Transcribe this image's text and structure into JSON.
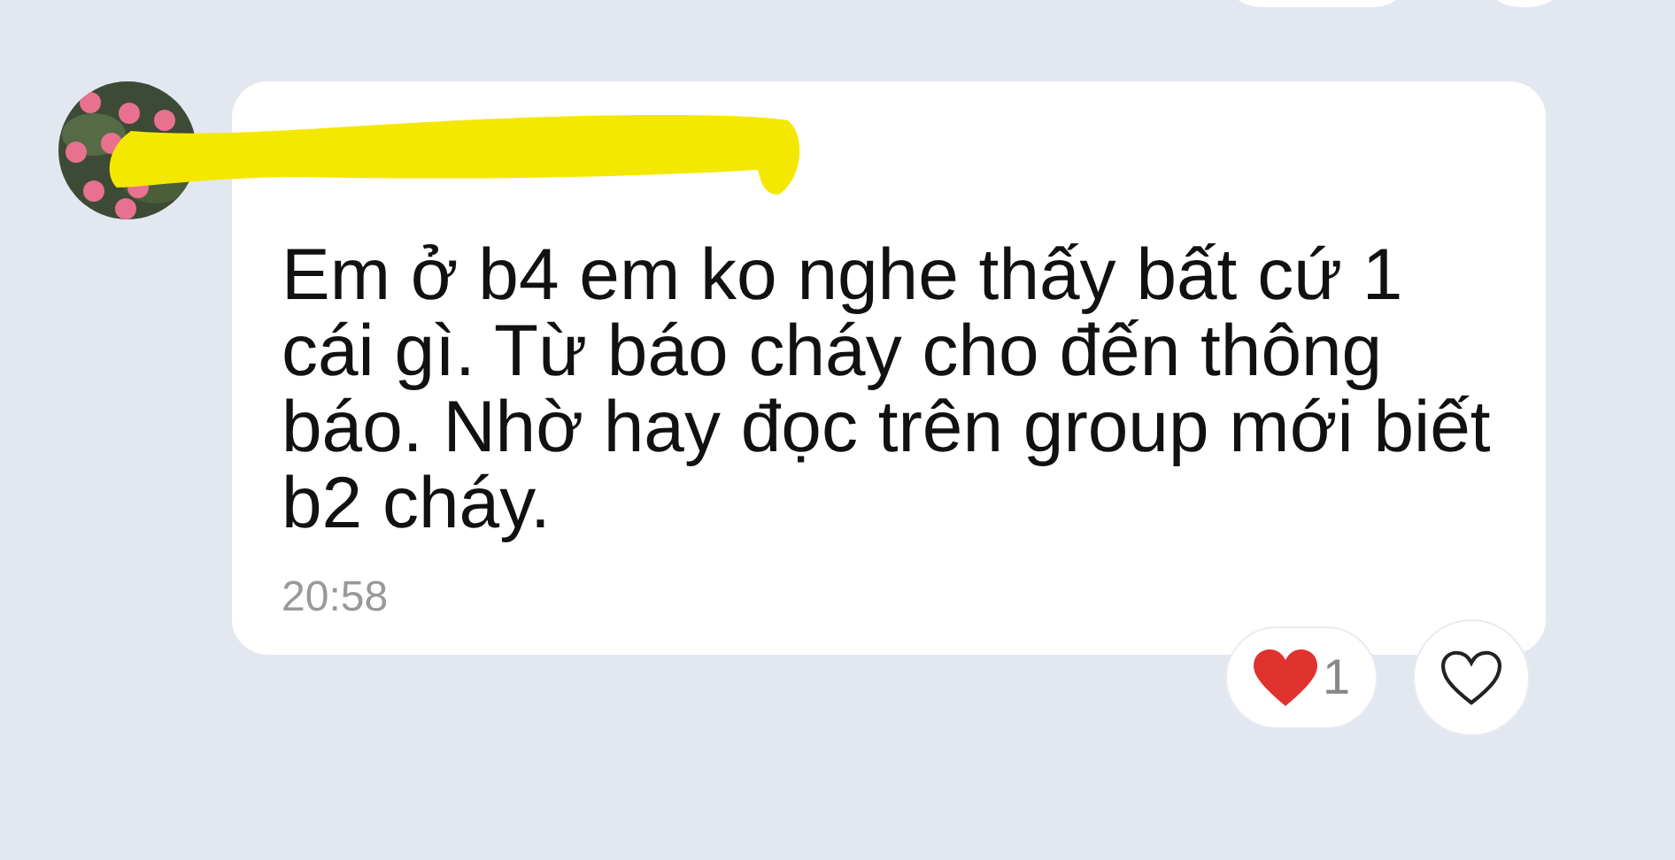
{
  "message": {
    "sender_redacted": true,
    "text": "Em ở b4 em ko nghe thấy bất cứ 1 cái gì. Từ báo cháy cho đến thông báo. Nhờ hay đọc trên group mới biết b2 cháy.",
    "time": "20:58"
  },
  "reaction": {
    "count": "1"
  }
}
